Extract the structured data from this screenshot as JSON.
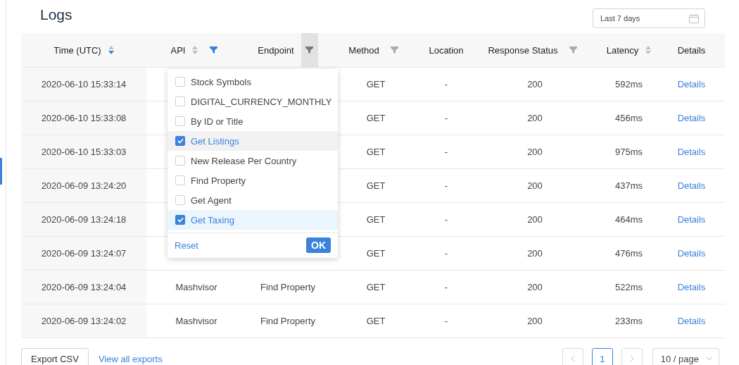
{
  "title": "Logs",
  "date_range": {
    "value": "Last 7 days"
  },
  "table": {
    "columns": [
      {
        "label": "Time (UTC)",
        "sort_active": true
      },
      {
        "label": "API",
        "sort_active": false,
        "filter_active": true,
        "filter_open": false
      },
      {
        "label": "Endpoint",
        "filter_active": false,
        "filter_open": true
      },
      {
        "label": "Method",
        "filter_active": false,
        "filter_open": false
      },
      {
        "label": "Location"
      },
      {
        "label": "Response Status",
        "filter_active": false,
        "filter_open": false
      },
      {
        "label": "Latency",
        "sort_active": false
      },
      {
        "label": "Details"
      }
    ],
    "rows": [
      {
        "time": "2020-06-10 15:33:14",
        "method": "GET",
        "location": "-",
        "status": "200",
        "latency": "592ms",
        "details": "Details"
      },
      {
        "time": "2020-06-10 15:33:08",
        "method": "GET",
        "location": "-",
        "status": "200",
        "latency": "456ms",
        "details": "Details"
      },
      {
        "time": "2020-06-10 15:33:03",
        "method": "GET",
        "location": "-",
        "status": "200",
        "latency": "975ms",
        "details": "Details"
      },
      {
        "time": "2020-06-09 13:24:20",
        "method": "GET",
        "location": "-",
        "status": "200",
        "latency": "437ms",
        "details": "Details"
      },
      {
        "time": "2020-06-09 13:24:18",
        "method": "GET",
        "location": "-",
        "status": "200",
        "latency": "464ms",
        "details": "Details"
      },
      {
        "time": "2020-06-09 13:24:07",
        "method": "GET",
        "location": "-",
        "status": "200",
        "latency": "476ms",
        "details": "Details"
      },
      {
        "time": "2020-06-09 13:24:04",
        "api": "Mashvisor",
        "endpoint": "Find Property",
        "method": "GET",
        "location": "-",
        "status": "200",
        "latency": "522ms",
        "details": "Details"
      },
      {
        "time": "2020-06-09 13:24:02",
        "api": "Mashvisor",
        "endpoint": "Find Property",
        "method": "GET",
        "location": "-",
        "status": "200",
        "latency": "233ms",
        "details": "Details"
      }
    ]
  },
  "endpoint_filter": {
    "options": [
      {
        "label": "Stock Symbols",
        "checked": false,
        "hovered": false
      },
      {
        "label": "DIGITAL_CURRENCY_MONTHLY",
        "checked": false,
        "hovered": false
      },
      {
        "label": "By ID or Title",
        "checked": false,
        "hovered": false
      },
      {
        "label": "Get Listings",
        "checked": true,
        "hovered": true
      },
      {
        "label": "New Release Per Country",
        "checked": false,
        "hovered": false
      },
      {
        "label": "Find Property",
        "checked": false,
        "hovered": false
      },
      {
        "label": "Get Agent",
        "checked": false,
        "hovered": false
      },
      {
        "label": "Get Taxing",
        "checked": true,
        "hovered": false
      }
    ],
    "reset": "Reset",
    "ok": "OK"
  },
  "footer": {
    "export": "Export CSV",
    "view_exports": "View all exports",
    "pages": [
      {
        "label": "1",
        "selected": true
      }
    ],
    "page_size": "10 / page"
  }
}
